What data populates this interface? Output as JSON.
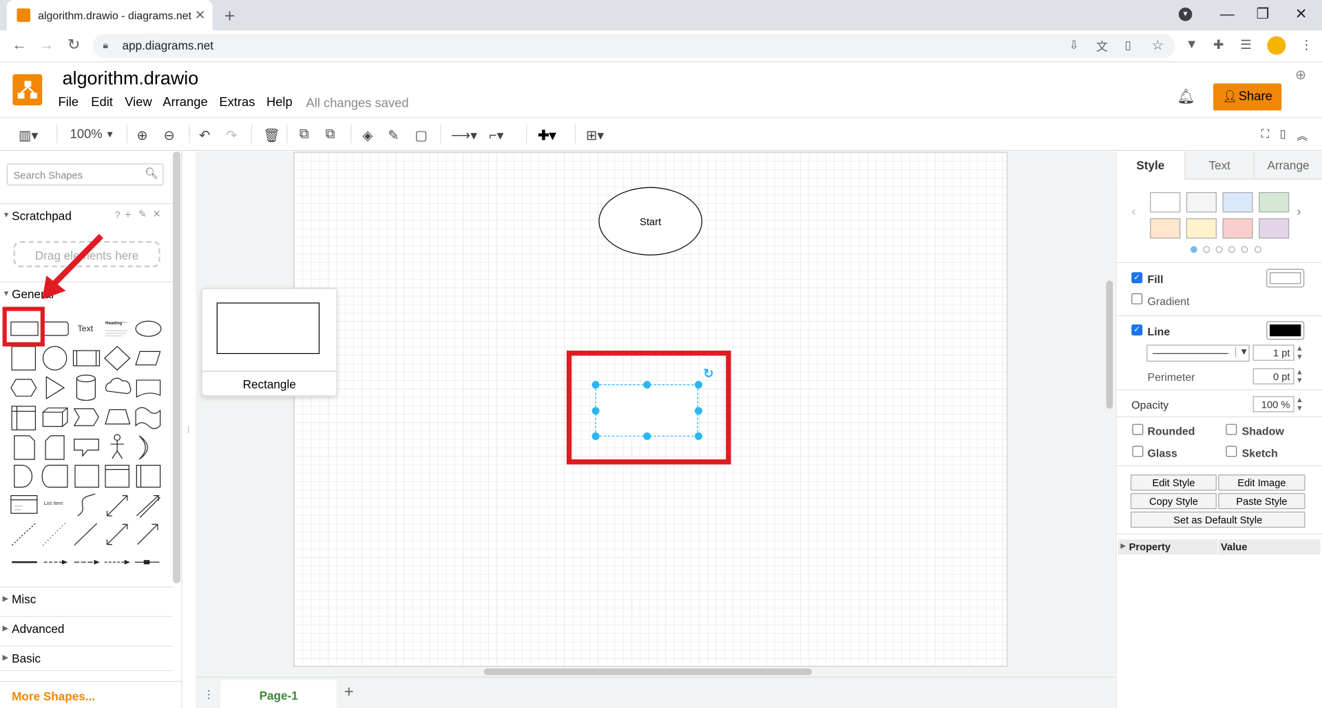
{
  "browser": {
    "tab_title": "algorithm.drawio - diagrams.net",
    "url": "app.diagrams.net"
  },
  "app": {
    "doc_title": "algorithm.drawio",
    "menus": [
      "File",
      "Edit",
      "View",
      "Arrange",
      "Extras",
      "Help"
    ],
    "status": "All changes saved",
    "share_label": "Share"
  },
  "toolbar": {
    "zoom": "100%"
  },
  "sidebar": {
    "search_placeholder": "Search Shapes",
    "scratchpad": "Scratchpad",
    "drop_hint": "Drag elements here",
    "general": "General",
    "text_shape": "Text",
    "heading_shape": "Heading",
    "list_item_shape": "List Item",
    "sections": [
      "Misc",
      "Advanced",
      "Basic"
    ],
    "more_shapes": "More Shapes..."
  },
  "canvas": {
    "start_label": "Start",
    "tooltip_label": "Rectangle",
    "page_tab": "Page-1"
  },
  "format_panel": {
    "tabs": [
      "Style",
      "Text",
      "Arrange"
    ],
    "swatches": [
      "#ffffff",
      "#f5f5f5",
      "#dae8fc",
      "#d5e8d4",
      "#ffe6cc",
      "#fff2cc",
      "#f8cecc",
      "#e1d5e7"
    ],
    "fill": "Fill",
    "gradient": "Gradient",
    "line": "Line",
    "line_width": "1 pt",
    "perimeter": "Perimeter",
    "perimeter_value": "0 pt",
    "opacity": "Opacity",
    "opacity_value": "100 %",
    "rounded": "Rounded",
    "shadow": "Shadow",
    "glass": "Glass",
    "sketch": "Sketch",
    "edit_style": "Edit Style",
    "edit_image": "Edit Image",
    "copy_style": "Copy Style",
    "paste_style": "Paste Style",
    "set_default": "Set as Default Style",
    "property_header": "Property",
    "value_header": "Value"
  },
  "colors": {
    "accent": "#f08705",
    "annotation_red": "#e11b22",
    "selection_blue": "#29b6f2"
  }
}
